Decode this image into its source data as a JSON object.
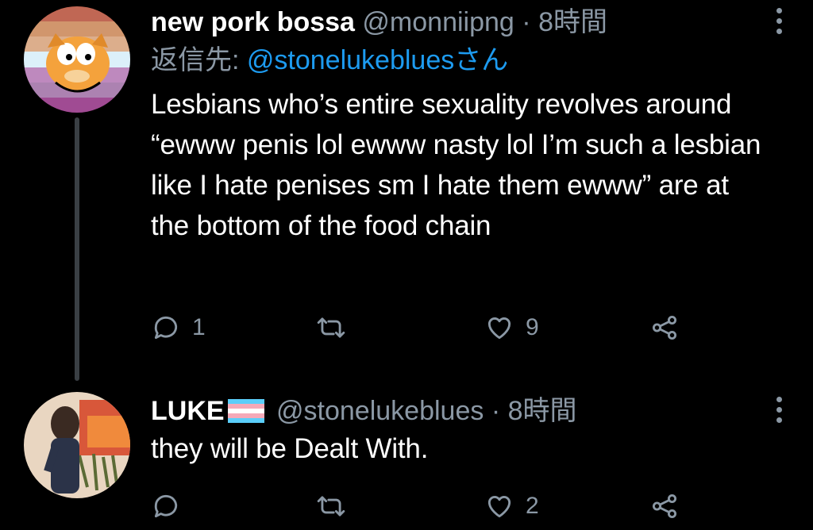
{
  "tweets": [
    {
      "display_name": "new pork bossa",
      "handle": "@monniipng",
      "dot": "·",
      "time": "8時間",
      "reply_prefix": "返信先: ",
      "reply_mention": "@stonelukebluesさん",
      "text": "Lesbians who’s entire sexuality revolves around “ewww penis lol ewww nasty lol I’m such a lesbian like I hate penises sm I hate them ewww” are at the bottom of the food chain",
      "reply_count": "1",
      "retweet_count": "",
      "like_count": "9"
    },
    {
      "display_name": "LUKE",
      "handle": "@stonelukeblues",
      "dot": "·",
      "time": "8時間",
      "text": "they will be Dealt With.",
      "reply_count": "",
      "retweet_count": "",
      "like_count": "2"
    }
  ],
  "colors": {
    "background": "#000000",
    "secondary_text": "#8b98a5",
    "mention": "#1d9bf0",
    "thread_line": "#3a3f44"
  },
  "icons": [
    "reply-icon",
    "retweet-icon",
    "like-icon",
    "share-icon",
    "more-icon",
    "trans-flag-icon"
  ]
}
